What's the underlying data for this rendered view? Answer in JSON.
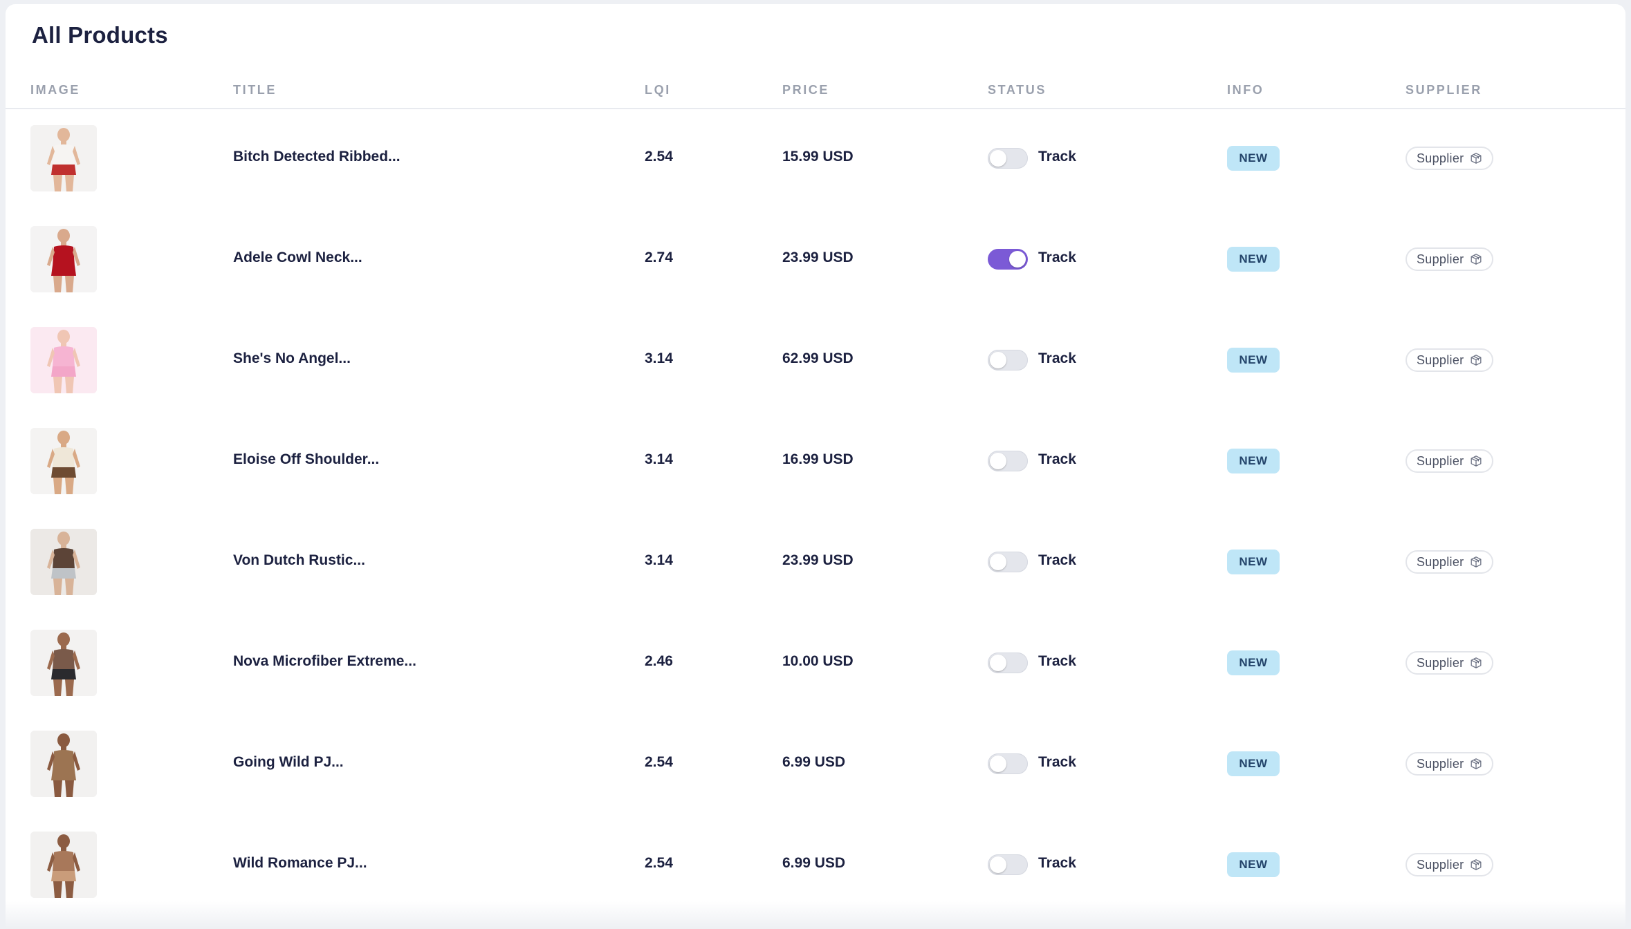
{
  "page": {
    "title": "All Products"
  },
  "table": {
    "columns": [
      "IMAGE",
      "TITLE",
      "LQI",
      "PRICE",
      "STATUS",
      "INFO",
      "SUPPLIER"
    ],
    "rows": [
      {
        "title": "Bitch Detected Ribbed...",
        "lqi": "2.54",
        "price": "15.99 USD",
        "track_on": false,
        "track_label": "Track",
        "info": "NEW",
        "supplier": "Supplier",
        "palette": {
          "top": "#f6f4f2",
          "bottom": "#c0302f",
          "skin": "#e2b79a",
          "bg": "#f3f2f1"
        }
      },
      {
        "title": "Adele Cowl Neck...",
        "lqi": "2.74",
        "price": "23.99 USD",
        "track_on": true,
        "track_label": "Track",
        "info": "NEW",
        "supplier": "Supplier",
        "palette": {
          "top": "#b5121f",
          "bottom": "#b5121f",
          "skin": "#d9a98c",
          "bg": "#f4f3f3"
        }
      },
      {
        "title": "She's No Angel...",
        "lqi": "3.14",
        "price": "62.99 USD",
        "track_on": false,
        "track_label": "Track",
        "info": "NEW",
        "supplier": "Supplier",
        "palette": {
          "top": "#f6b4d2",
          "bottom": "#f3a6c8",
          "skin": "#f0c6b4",
          "bg": "#fbe9f1"
        }
      },
      {
        "title": "Eloise Off Shoulder...",
        "lqi": "3.14",
        "price": "16.99 USD",
        "track_on": false,
        "track_label": "Track",
        "info": "NEW",
        "supplier": "Supplier",
        "palette": {
          "top": "#efe7d8",
          "bottom": "#6e4b32",
          "skin": "#d9a985",
          "bg": "#f4f3f2"
        }
      },
      {
        "title": "Von Dutch Rustic...",
        "lqi": "3.14",
        "price": "23.99 USD",
        "track_on": false,
        "track_label": "Track",
        "info": "NEW",
        "supplier": "Supplier",
        "palette": {
          "top": "#5c4437",
          "bottom": "#bfc3c7",
          "skin": "#d8b398",
          "bg": "#ece9e6"
        }
      },
      {
        "title": "Nova Microfiber Extreme...",
        "lqi": "2.46",
        "price": "10.00 USD",
        "track_on": false,
        "track_label": "Track",
        "info": "NEW",
        "supplier": "Supplier",
        "palette": {
          "top": "#7a5a4a",
          "bottom": "#2a2a2e",
          "skin": "#9b6a4e",
          "bg": "#f3f2f1"
        }
      },
      {
        "title": "Going Wild PJ...",
        "lqi": "2.54",
        "price": "6.99 USD",
        "track_on": false,
        "track_label": "Track",
        "info": "NEW",
        "supplier": "Supplier",
        "palette": {
          "top": "#9c7452",
          "bottom": "#9c7452",
          "skin": "#8a5a40",
          "bg": "#f2f1f0"
        }
      },
      {
        "title": "Wild Romance PJ...",
        "lqi": "2.54",
        "price": "6.99 USD",
        "track_on": false,
        "track_label": "Track",
        "info": "NEW",
        "supplier": "Supplier",
        "palette": {
          "top": "#a8785a",
          "bottom": "#c99c7a",
          "skin": "#8c5c42",
          "bg": "#f2f1f0"
        }
      }
    ]
  },
  "colors": {
    "accent_toggle_on": "#7b5ad6",
    "badge_bg": "#bfe6f7",
    "text_primary": "#1c2140",
    "header_text": "#9aa0ad"
  },
  "icons": {
    "supplier": "box-icon"
  }
}
